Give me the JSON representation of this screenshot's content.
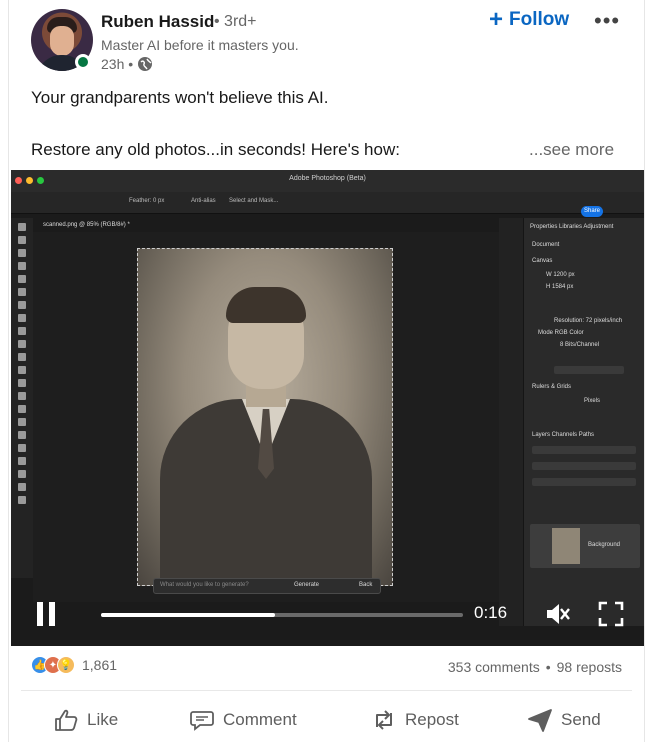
{
  "author": {
    "name": "Ruben Hassid",
    "degree": "• 3rd+",
    "headline": "Master AI before it masters you.",
    "time": "23h •"
  },
  "actions_top": {
    "follow_label": "Follow",
    "more_label": "•••"
  },
  "post": {
    "line1": "Your grandparents won't believe this AI.",
    "line2": "Restore any old photos...in seconds! Here's how:",
    "see_more": "...see more"
  },
  "video": {
    "app_title": "Adobe Photoshop (Beta)",
    "document_tab": "scanned.png @ 85% (RGB/8#) *",
    "options_feather": "Feather: 0 px",
    "options_antialias": "Anti-alias",
    "options_select_mask": "Select and Mask...",
    "share_label": "Share",
    "panel_tabs": "Properties  Libraries  Adjustment",
    "panel_document": "Document",
    "panel_canvas": "Canvas",
    "panel_width": "W  1200 px",
    "panel_height": "H  1584 px",
    "panel_resolution": "Resolution: 72 pixels/inch",
    "panel_mode": "Mode   RGB Color",
    "panel_bits": "8 Bits/Channel",
    "panel_rulers": "Rulers & Grids",
    "panel_units": "Pixels",
    "layers_tabs": "Layers   Channels   Paths",
    "layer_name": "Background",
    "gen_placeholder": "What would you like to generate?",
    "gen_button": "Generate",
    "gen_back": "Back",
    "time": "0:16",
    "progress": 0.48,
    "colors": {
      "ps_bg": "#1b1b1b",
      "accent_blue": "#1473e6"
    }
  },
  "social": {
    "reaction_count": "1,861",
    "comments": "353 comments",
    "separator": "•",
    "reposts": "98 reposts",
    "reaction_icons": [
      "like-icon",
      "celebrate-icon",
      "insightful-icon"
    ]
  },
  "bottom_actions": {
    "like": "Like",
    "comment": "Comment",
    "repost": "Repost",
    "send": "Send"
  },
  "colors": {
    "link_blue": "#0a66c2",
    "online_green": "#057642",
    "muted_text": "#666666"
  }
}
